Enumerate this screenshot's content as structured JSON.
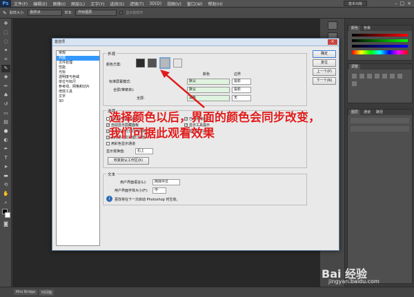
{
  "app": {
    "logo": "Ps",
    "workspace": "基本功能"
  },
  "menu": [
    "文件(F)",
    "编辑(E)",
    "图像(I)",
    "图层(L)",
    "文字(Y)",
    "选择(S)",
    "滤镜(T)",
    "3D(D)",
    "视图(V)",
    "窗口(W)",
    "帮助(H)"
  ],
  "options": {
    "sample_size_label": "取样大小:",
    "sample_size": "取样点",
    "sample_label": "样本:",
    "sample": "所有图层",
    "show_ring": "显示取样环"
  },
  "panels": {
    "color_tabs": [
      "颜色",
      "色板"
    ],
    "adjust_tab": "调整",
    "layers_tabs": [
      "图层",
      "通道",
      "路径"
    ]
  },
  "status": [
    "Mini Bridge",
    "时间轴"
  ],
  "dialog": {
    "title": "首选项",
    "categories": [
      "常规",
      "界面",
      "文件处理",
      "性能",
      "光标",
      "透明度与色域",
      "单位与标尺",
      "参考线、网格和切片",
      "增效工具",
      "文字",
      "3D"
    ],
    "selected_category": "界面",
    "appearance": {
      "group_title": "外观",
      "color_scheme_label": "颜色方案:",
      "swatches": [
        "#2b2b2b",
        "#535353",
        "#b8b8b8",
        "#e5e5e5"
      ],
      "col_color": "颜色",
      "col_border": "边界",
      "rows": [
        {
          "label": "标准屏幕模式:",
          "color": "默认",
          "border": "投影"
        },
        {
          "label": "全屏(带菜单):",
          "color": "默认",
          "border": "投影"
        },
        {
          "label": "全屏:",
          "color": "黑色",
          "border": "无"
        }
      ]
    },
    "options": {
      "group_title": "选项",
      "checks": [
        {
          "label": "自动折叠图标面板",
          "checked": false
        },
        {
          "label": "自动显示隐藏面板",
          "checked": true
        },
        {
          "label": "以选项卡方式打开文档",
          "checked": true
        },
        {
          "label": "启用浮动文档窗口停放",
          "checked": true
        },
        {
          "label": "用彩色显示通道",
          "checked": false
        }
      ],
      "right_checks": [
        {
          "label": "已启用动画",
          "checked": true
        },
        {
          "label": "显示工具提示",
          "checked": true
        },
        {
          "label": "显示文本提示",
          "checked": true
        }
      ],
      "transform_label": "显示变换值:",
      "transform_value": "右上",
      "reset_button": "恢复默认工作区(K)"
    },
    "text": {
      "group_title": "文本",
      "ui_lang_label": "用户界面语言(L):",
      "ui_lang": "简体中文",
      "ui_font_label": "用户界面字体大小(F):",
      "ui_font": "中",
      "note": "更改将在下一次启动 Photoshop 时生效。"
    },
    "buttons": [
      "确定",
      "复位",
      "上一个(P)",
      "下一个(N)"
    ]
  },
  "annotation": "选择颜色以后，界面的颜色会同步改变，我们可据此观看效果",
  "watermark": {
    "brand": "Bai 经验",
    "url": "jingyan.baidu.com"
  }
}
